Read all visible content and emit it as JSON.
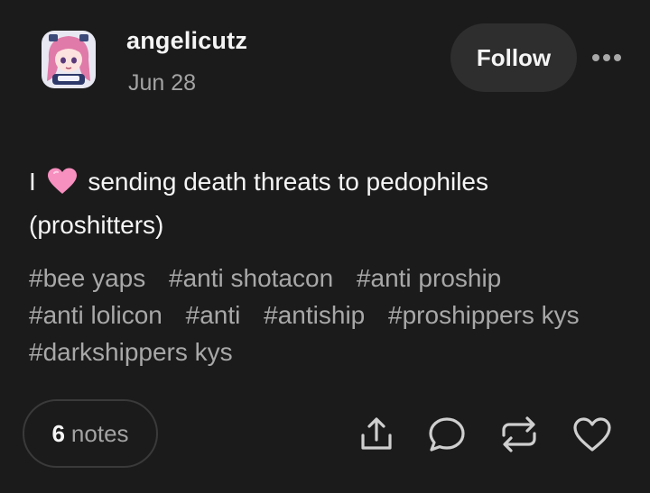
{
  "post": {
    "username": "angelicutz",
    "date": "Jun 28",
    "follow_label": "Follow",
    "more_icon": "ellipsis-icon",
    "text_before": "I",
    "text_emoji": "pink-heart-emoji",
    "text_after": "sending death threats to pedophiles (proshitters)",
    "tags": [
      "#bee yaps",
      "#anti shotacon",
      "#anti proship",
      "#anti lolicon",
      "#anti",
      "#antiship",
      "#proshippers kys",
      "#darkshippers kys"
    ]
  },
  "footer": {
    "notes_count": "6",
    "notes_label": "notes",
    "actions": [
      "share-icon",
      "comment-icon",
      "reblog-icon",
      "like-icon"
    ]
  },
  "colors": {
    "background": "#1b1b1b",
    "button_bg": "#2e2e2e",
    "muted_text": "#a3a3a3",
    "heart_pink": "#f78fbf"
  }
}
